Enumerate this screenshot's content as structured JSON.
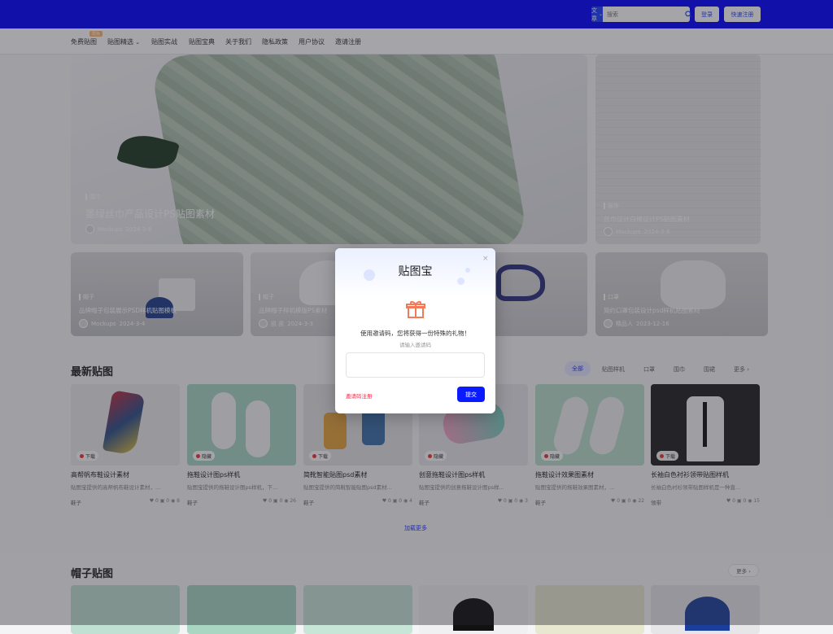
{
  "header": {
    "search_category": "文章",
    "search_placeholder": "搜索",
    "login": "登录",
    "register": "快速注册"
  },
  "nav": {
    "items": [
      "免费贴图",
      "贴图精选",
      "贴图实战",
      "贴图宝典",
      "关于我们",
      "隐私政策",
      "用户协议",
      "邀请注册"
    ],
    "badge": "限免"
  },
  "hero": {
    "main": {
      "tag": "围巾",
      "title": "墨绿丝巾产品设计PS贴图素材",
      "author": "Mockups",
      "date": "2024-3-8"
    },
    "side": {
      "tag": "服饰",
      "title": "丝巾设计白模设计PS贴图素材",
      "author": "Mockups",
      "date": "2024-3-8"
    }
  },
  "small_cards": [
    {
      "tag": "帽子",
      "title": "品牌帽子包装展示PSD样机贴图模板",
      "author": "Mockups",
      "date": "2024-3-4"
    },
    {
      "tag": "帽子",
      "title": "品牌帽子样机模版PS素材",
      "author": "凯 凯",
      "date": "2024-3-3"
    },
    {
      "tag": "",
      "title": "",
      "author": "",
      "date": ""
    },
    {
      "tag": "口罩",
      "title": "简约口罩包装设计psd样机贴图素材",
      "author": "精品人",
      "date": "2023-12-16"
    }
  ],
  "latest": {
    "title": "最新贴图",
    "filters": {
      "active": "全部",
      "items": [
        "贴图样机",
        "口罩",
        "围巾",
        "围裙",
        "更多 ›"
      ]
    },
    "products": [
      {
        "badge": "下载",
        "title": "高帮帆布鞋设计素材",
        "desc": "贴图宝提供的高帮帆布鞋设计素材，...",
        "cat": "鞋子",
        "stats": "♥ 0   ▣ 0   ◉ 8"
      },
      {
        "badge": "隐藏",
        "title": "拖鞋设计图ps样机",
        "desc": "贴图宝提供的拖鞋设计图ps样机，下...",
        "cat": "鞋子",
        "stats": "♥ 0   ▣ 0   ◉ 26"
      },
      {
        "badge": "下载",
        "title": "简靴智能贴图psd素材",
        "desc": "贴图宝提供的简靴智能贴图psd素材...",
        "cat": "鞋子",
        "stats": "♥ 0   ▣ 0   ◉ 4"
      },
      {
        "badge": "隐藏",
        "title": "创意拖鞋设计图ps样机",
        "desc": "贴图宝提供的创意拖鞋设计图ps样...",
        "cat": "鞋子",
        "stats": "♥ 0   ▣ 0   ◉ 3"
      },
      {
        "badge": "隐藏",
        "title": "拖鞋设计效果图素材",
        "desc": "贴图宝提供的拖鞋效果图素材，...",
        "cat": "鞋子",
        "stats": "♥ 0   ▣ 0   ◉ 22"
      },
      {
        "badge": "下载",
        "title": "长袖白色衬衫领带贴图样机",
        "desc": "长袖白色衬衫领带贴图样机是一种直...",
        "cat": "领带",
        "stats": "♥ 0   ▣ 0   ◉ 15"
      }
    ],
    "load_more": "加载更多"
  },
  "caps": {
    "title": "帽子贴图",
    "more": "更多 ›"
  },
  "modal": {
    "title": "贴图宝",
    "close": "×",
    "message": "使用邀请码，您将获得一份特殊的礼物！",
    "hint": "请输入邀请码",
    "input_placeholder": "",
    "link": "邀请码注册",
    "submit": "提交"
  },
  "colors": {
    "brand": "#0000ff",
    "accent": "#0a1cff",
    "link_red": "#ff2b4a"
  }
}
